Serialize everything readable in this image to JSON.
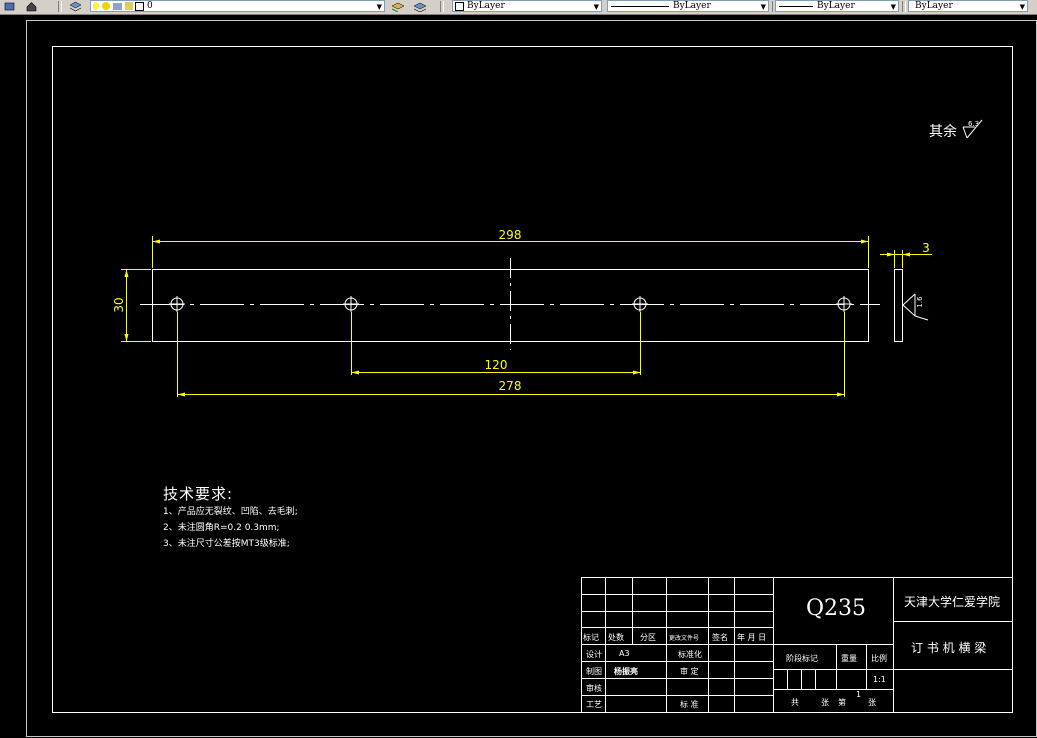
{
  "toolbar": {
    "layer_name": "0",
    "color": "ByLayer",
    "linetype": "ByLayer",
    "lineweight": "ByLayer",
    "plotstyle": "ByLayer"
  },
  "drawing": {
    "dimensions": {
      "overall_length": "298",
      "height": "30",
      "hole_spacing_inner": "120",
      "hole_spacing_outer": "278",
      "thickness": "3"
    },
    "roughness_small": "1.6",
    "surface_note": "其余",
    "surface_note_value": "6.3",
    "technical_requirements": {
      "title": "技术要求:",
      "items": [
        "1、产品应无裂纹、凹陷、去毛刺;",
        "2、未注圆角R=0.2  0.3mm;",
        "3、未注尺寸公差按MT3级标准;"
      ]
    }
  },
  "title_block": {
    "material": "Q235",
    "institution": "天津大学仁爱学院",
    "part_name": "订 书 机 横 梁",
    "rev_headers": [
      "标记",
      "处数",
      "分区",
      "更改文件号",
      "签名",
      "年 月 日"
    ],
    "design_label": "设计",
    "design_value": "A3",
    "standardization_label": "标准化",
    "drafting_label": "制图",
    "drafting_value": "杨振亮",
    "check_label": "审  定",
    "review_label": "审核",
    "process_label": "工艺",
    "approve_label": "标  准",
    "stage_label": "阶段标记",
    "weight_label": "重量",
    "scale_label": "比例",
    "scale_value": "1:1",
    "sheets_total_label": "共",
    "sheets_label": "张",
    "sheet_no_label": "第",
    "sheet_no_value": "1",
    "sheet_unit": "张"
  },
  "colors": {
    "background": "#000000",
    "border": "#ffffff",
    "dimension": "#ffff00",
    "object_line": "#ffffff"
  }
}
